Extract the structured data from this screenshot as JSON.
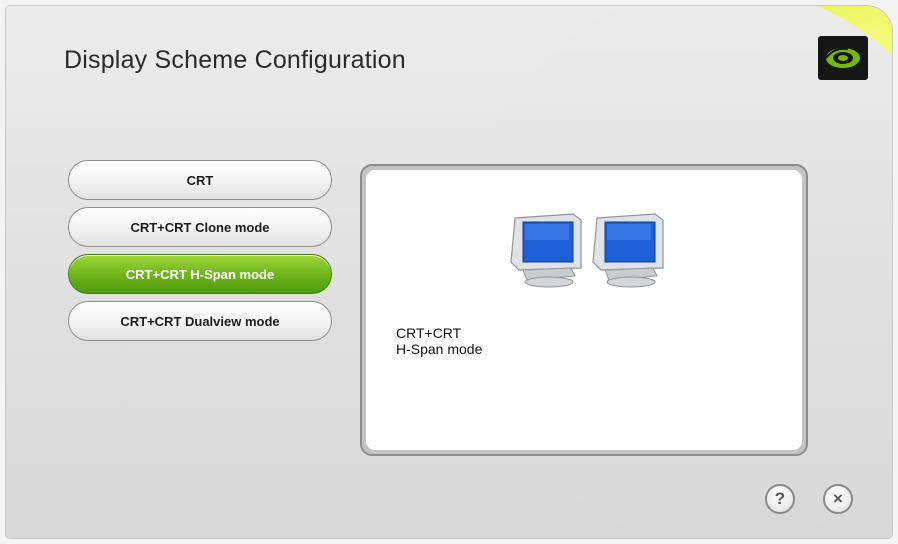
{
  "title": "Display Scheme Configuration",
  "schemes": [
    {
      "label": "CRT"
    },
    {
      "label": "CRT+CRT Clone mode"
    },
    {
      "label": "CRT+CRT H-Span mode",
      "selected": true
    },
    {
      "label": "CRT+CRT Dualview mode"
    }
  ],
  "preview": {
    "caption_line1": "CRT+CRT",
    "caption_line2": "H-Span mode",
    "icon": "two-crt-monitors-icon"
  },
  "buttons": {
    "help_symbol": "?",
    "close_symbol": "×"
  },
  "colors": {
    "accent_green": "#6fb51b",
    "logo_green": "#76b900",
    "swoosh_yellow": "#e3f04a"
  }
}
